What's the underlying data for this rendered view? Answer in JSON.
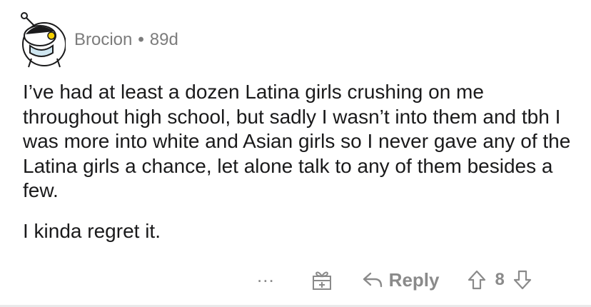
{
  "comment": {
    "username": "Brocion",
    "separator": "•",
    "age": "89d",
    "paragraphs": [
      "I’ve had at least a dozen Latina girls crushing on me throughout high school, but sadly I wasn’t into them and tbh I was more into white and Asian girls so I never gave any of the Latina girls a chance, let alone talk to any of them besides a few.",
      "I kinda regret it."
    ],
    "actions": {
      "more": "...",
      "award_icon": "gift-award-icon",
      "reply_label": "Reply",
      "vote_count": "8"
    }
  },
  "colors": {
    "text": "#1a1a1b",
    "meta": "#7c7c7c",
    "actions": "#8a8a8a",
    "divider": "#e9e9ea"
  }
}
